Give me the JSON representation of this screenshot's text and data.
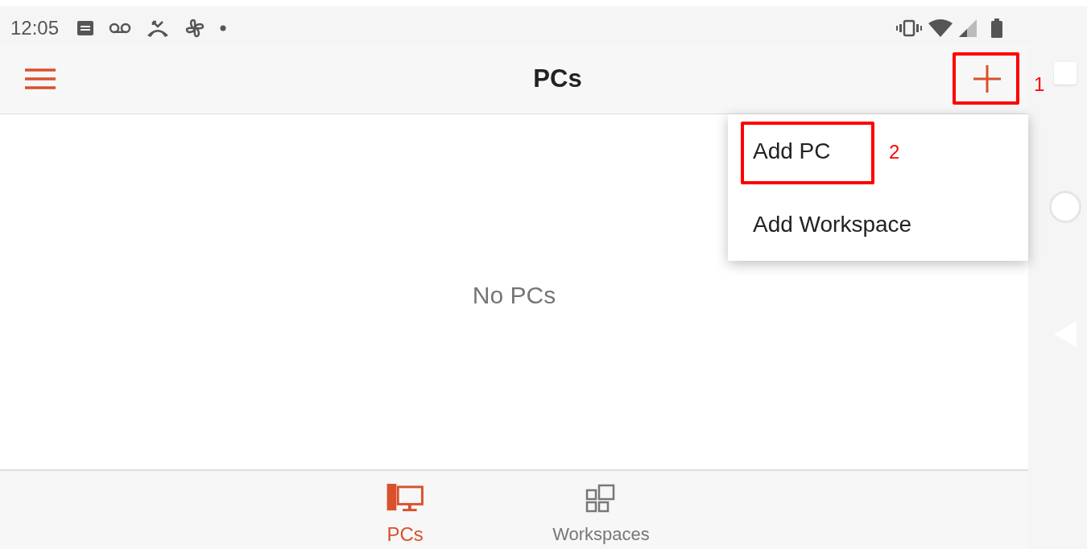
{
  "status_bar": {
    "time": "12:05"
  },
  "app_bar": {
    "title": "PCs"
  },
  "menu": {
    "items": [
      {
        "label": "Add PC"
      },
      {
        "label": "Add Workspace"
      }
    ]
  },
  "content": {
    "empty_message": "No PCs"
  },
  "bottom_nav": [
    {
      "kind": "pcs",
      "label": "PCs",
      "selected": true
    },
    {
      "kind": "workspaces",
      "label": "Workspaces",
      "selected": false
    }
  ],
  "annotations": [
    {
      "label": "1"
    },
    {
      "label": "2"
    }
  ]
}
